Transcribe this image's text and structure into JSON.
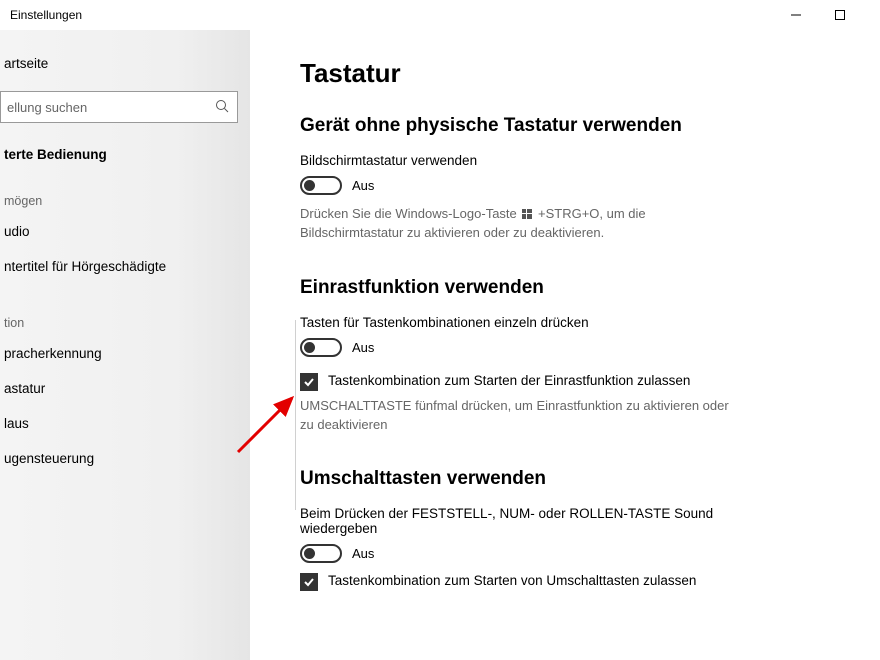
{
  "window": {
    "title": "Einstellungen"
  },
  "sidebar": {
    "home": "artseite",
    "search_placeholder": "ellung suchen",
    "category": "terte Bedienung",
    "groups": [
      {
        "label": "mögen",
        "items": [
          "udio",
          "ntertitel für Hörgeschädigte"
        ]
      },
      {
        "label": "tion",
        "items": [
          "pracherkennung",
          "astatur",
          "laus",
          "ugensteuerung"
        ]
      }
    ]
  },
  "page": {
    "title": "Tastatur",
    "sections": [
      {
        "heading": "Gerät ohne physische Tastatur verwenden",
        "setting_label": "Bildschirmtastatur verwenden",
        "toggle_state": "Aus",
        "hint": "Drücken Sie die Windows-Logo-Taste  +STRG+O, um die Bildschirmtastatur zu aktivieren oder zu deaktivieren."
      },
      {
        "heading": "Einrastfunktion verwenden",
        "setting_label": "Tasten für Tastenkombinationen einzeln drücken",
        "toggle_state": "Aus",
        "checkbox_label": "Tastenkombination zum Starten der Einrastfunktion zulassen",
        "hint": "UMSCHALTTASTE fünfmal drücken, um Einrastfunktion zu aktivieren oder zu deaktivieren"
      },
      {
        "heading": "Umschalttasten verwenden",
        "setting_label": "Beim Drücken der FESTSTELL-, NUM- oder ROLLEN-TASTE Sound wiedergeben",
        "toggle_state": "Aus",
        "checkbox_label": "Tastenkombination zum Starten von Umschalttasten zulassen"
      }
    ]
  }
}
